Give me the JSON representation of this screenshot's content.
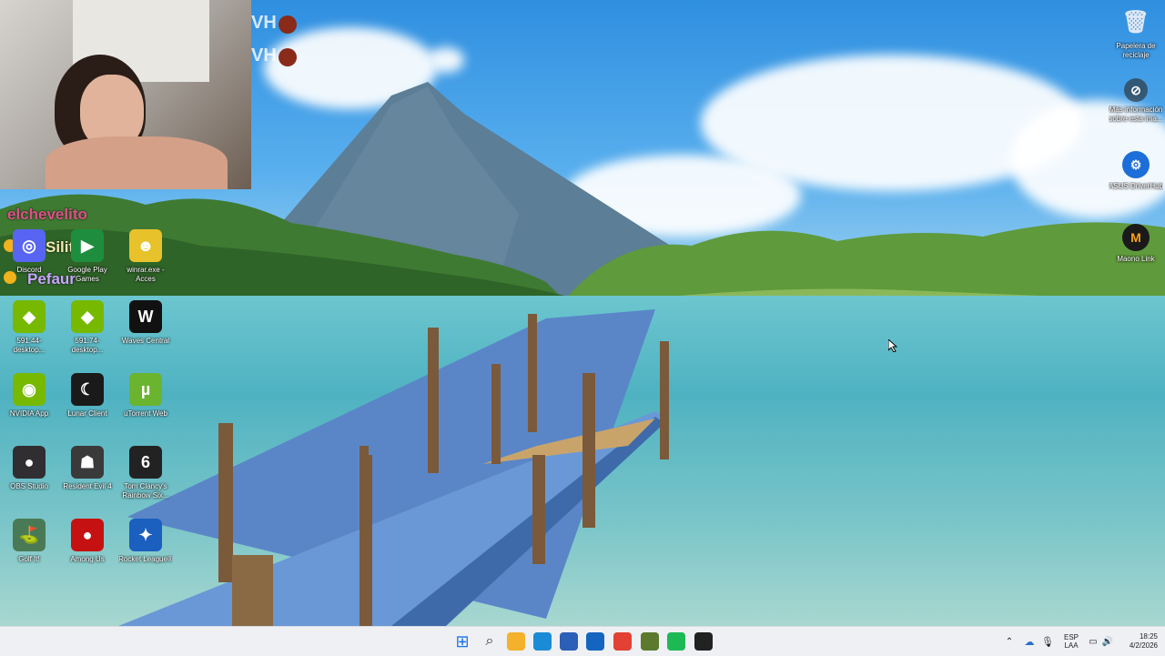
{
  "overlay": {
    "stream_marks": [
      "VH",
      "VH"
    ],
    "chat": [
      {
        "name": "elchevelito",
        "color": "#e0508a"
      },
      {
        "name": "Silitoo",
        "color": "#f4e9b0"
      },
      {
        "name": "Pefaur",
        "color": "#c9a7ff"
      }
    ]
  },
  "desktop": {
    "icons": [
      {
        "name": "Discord",
        "icon": "discord-icon",
        "color": "#5865f2",
        "glyph": "◎"
      },
      {
        "name": "Google Play Games",
        "icon": "google-play-games-icon",
        "color": "#1e8e3e",
        "glyph": "▶"
      },
      {
        "name": "winrar.exe - Acces",
        "icon": "minion-icon",
        "color": "#e8c22a",
        "glyph": "☻"
      },
      {
        "name": "591.44-desktop...",
        "icon": "nvidia-installer-icon",
        "color": "#76b900",
        "glyph": "◆"
      },
      {
        "name": "591.74-desktop...",
        "icon": "nvidia-installer-icon",
        "color": "#76b900",
        "glyph": "◆"
      },
      {
        "name": "Waves Central",
        "icon": "waves-central-icon",
        "color": "#111111",
        "glyph": "W"
      },
      {
        "name": "NVIDIA App",
        "icon": "nvidia-app-icon",
        "color": "#76b900",
        "glyph": "◉"
      },
      {
        "name": "Lunar Client",
        "icon": "lunar-client-icon",
        "color": "#1a1a1a",
        "glyph": "☾"
      },
      {
        "name": "uTorrent Web",
        "icon": "utorrent-icon",
        "color": "#6ab42f",
        "glyph": "µ"
      },
      {
        "name": "OBS Studio",
        "icon": "obs-icon",
        "color": "#302e31",
        "glyph": "●"
      },
      {
        "name": "Resident Evil 4",
        "icon": "resident-evil-icon",
        "color": "#3a3a3a",
        "glyph": "☗"
      },
      {
        "name": "Tom Clancy's Rainbow Six...",
        "icon": "rainbow-six-icon",
        "color": "#222222",
        "glyph": "6"
      },
      {
        "name": "Golf It!",
        "icon": "golf-it-icon",
        "color": "#4a7a55",
        "glyph": "⛳"
      },
      {
        "name": "Among Us",
        "icon": "among-us-icon",
        "color": "#c51111",
        "glyph": "●"
      },
      {
        "name": "Rocket League®",
        "icon": "rocket-league-icon",
        "color": "#1b5fbf",
        "glyph": "✦"
      }
    ],
    "right_icons": [
      {
        "name": "Papelera de reciclaje",
        "icon": "recycle-bin-icon"
      },
      {
        "name": "Más información sobre esta ima...",
        "icon": "spotlight-info-icon"
      },
      {
        "name": "ASUS DriverHub",
        "icon": "asus-driverhub-icon"
      },
      {
        "name": "Maono Link",
        "icon": "maono-link-icon"
      }
    ]
  },
  "taskbar": {
    "apps": [
      {
        "icon": "windows-start-icon",
        "color": "#1a73e8"
      },
      {
        "icon": "search-icon",
        "color": "#333333"
      },
      {
        "icon": "file-explorer-icon",
        "color": "#f3b12c"
      },
      {
        "icon": "edge-icon",
        "color": "#1b8bd6"
      },
      {
        "icon": "microsoft-store-icon",
        "color": "#2b5fb8"
      },
      {
        "icon": "outlook-icon",
        "color": "#1565c0"
      },
      {
        "icon": "chrome-icon",
        "color": "#e24133"
      },
      {
        "icon": "minecraft-icon",
        "color": "#5b7a2e"
      },
      {
        "icon": "spotify-icon",
        "color": "#1db954"
      },
      {
        "icon": "recording-app-icon",
        "color": "#222222"
      }
    ],
    "tray": {
      "lang_1": "ESP",
      "lang_2": "LAA",
      "time": "18:25",
      "date": "4/2/2026"
    }
  }
}
